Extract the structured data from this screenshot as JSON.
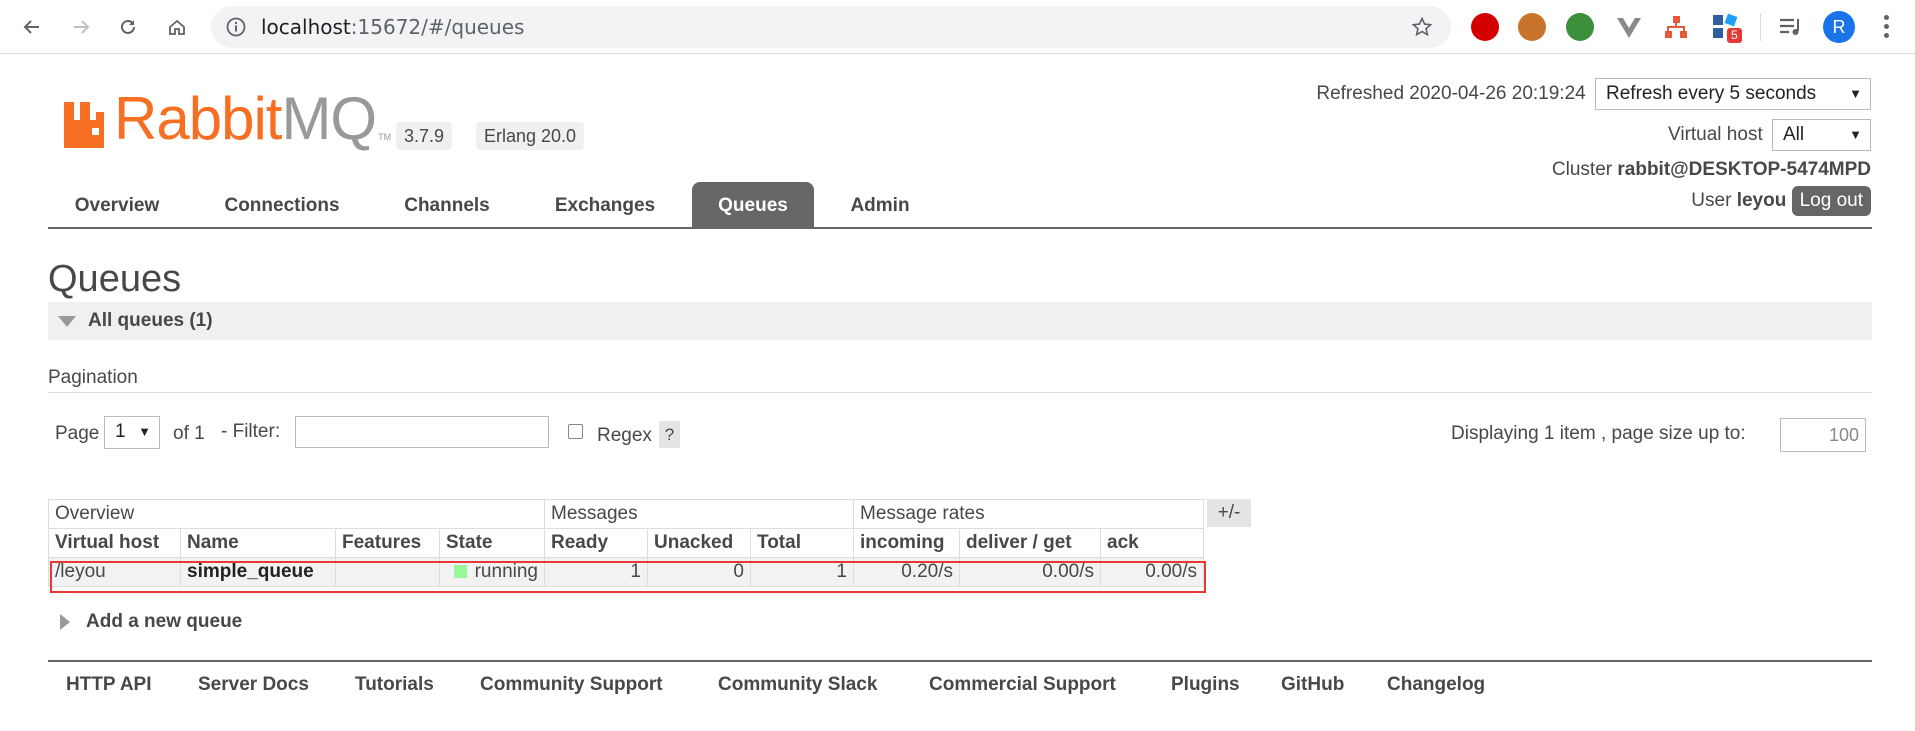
{
  "browser": {
    "url_host": "localhost",
    "url_path": ":15672/#/queues",
    "profile_initial": "R",
    "extension_badge": "5"
  },
  "brand": {
    "name_rabbit": "Rabbit",
    "name_mq": "MQ",
    "tm": "TM",
    "version": "3.7.9",
    "erlang": "Erlang 20.0"
  },
  "header": {
    "refreshed_label": "Refreshed 2020-04-26 20:19:24",
    "refresh_select": "Refresh every 5 seconds",
    "vhost_label": "Virtual host",
    "vhost_select": "All",
    "cluster_label": "Cluster",
    "cluster_value": "rabbit@DESKTOP-5474MPD",
    "user_label": "User",
    "user_value": "leyou",
    "logout_label": "Log out"
  },
  "tabs": [
    "Overview",
    "Connections",
    "Channels",
    "Exchanges",
    "Queues",
    "Admin"
  ],
  "active_tab": "Queues",
  "page": {
    "title": "Queues",
    "section_title": "All queues (1)",
    "pagination_label": "Pagination",
    "page_label": "Page",
    "page_value": "1",
    "of_label": "of 1",
    "filter_label": "- Filter:",
    "filter_value": "",
    "regex_label": "Regex",
    "help_label": "?",
    "displaying_label": "Displaying 1 item , page size up to:",
    "page_size": "100",
    "plusminus": "+/-",
    "add_queue": "Add a new queue"
  },
  "table": {
    "groups": [
      "Overview",
      "Messages",
      "Message rates"
    ],
    "columns": [
      "Virtual host",
      "Name",
      "Features",
      "State",
      "Ready",
      "Unacked",
      "Total",
      "incoming",
      "deliver / get",
      "ack"
    ],
    "rows": [
      {
        "vhost": "/leyou",
        "name": "simple_queue",
        "features": "",
        "state": "running",
        "ready": "1",
        "unacked": "0",
        "total": "1",
        "incoming": "0.20/s",
        "deliver_get": "0.00/s",
        "ack": "0.00/s"
      }
    ]
  },
  "footer": [
    "HTTP API",
    "Server Docs",
    "Tutorials",
    "Community Support",
    "Community Slack",
    "Commercial Support",
    "Plugins",
    "GitHub",
    "Changelog"
  ],
  "colors": {
    "brand_orange": "#f76f23",
    "tab_active": "#666666",
    "state_running": "#98f898",
    "highlight": "#e53935"
  }
}
